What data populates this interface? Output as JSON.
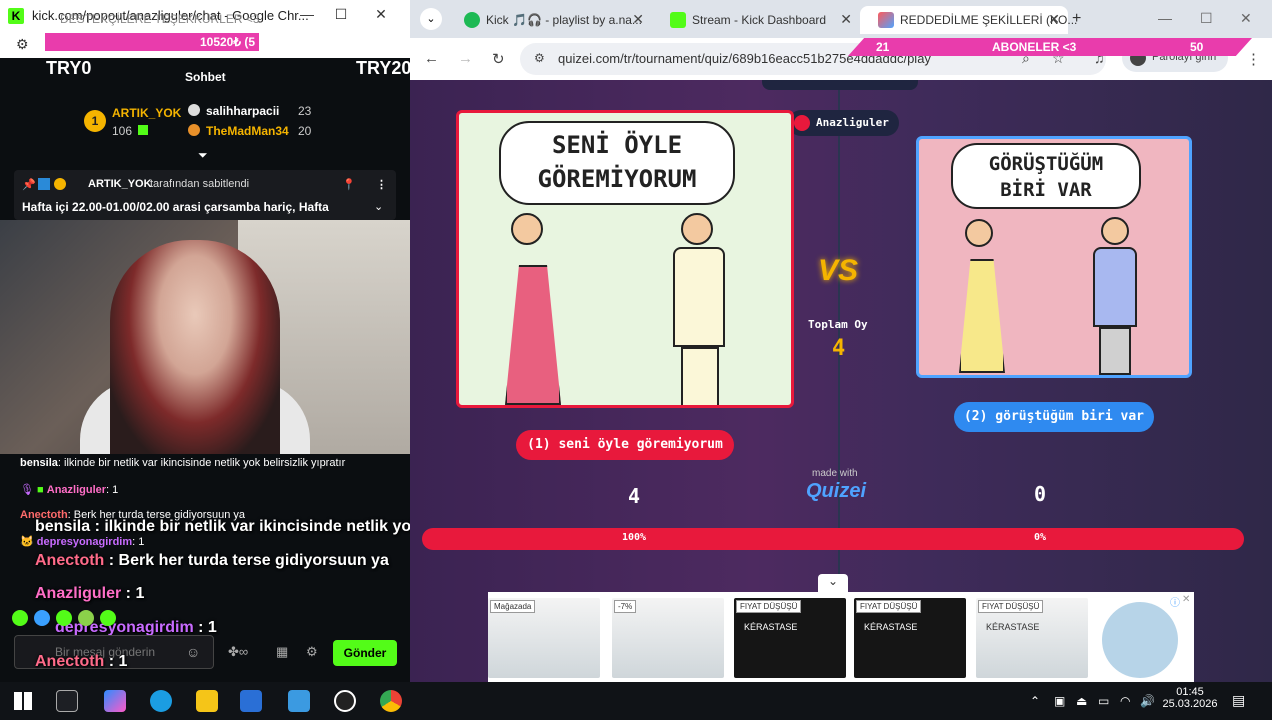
{
  "left_window": {
    "title": "kick.com/popout/anazliguler/chat - Google Chr...",
    "progress_text": "10520₺ (5",
    "overlay_faded": "DESTEKÇİLERE TEŞEKKÜRLER <3",
    "try_left": "TRY0",
    "try_right": "TRY20...",
    "tab_title": "Sohbet",
    "leaders": [
      {
        "name": "ARTIK_YOK",
        "count": "106",
        "rank": "1"
      },
      {
        "name": "salihharpacii",
        "count": "23"
      },
      {
        "name": "TheMadMan34",
        "count": "20"
      }
    ],
    "pinned": {
      "by": "ARTIK_YOK",
      "suffix": "tarafından sabitlendi",
      "text": "Hafta içi 22.00-01.00/02.00 arasi çarsamba hariç, Hafta"
    },
    "chat": [
      {
        "user": "bensila",
        "sep": ":",
        "text": "ilkinde bir netlik var ikincisinde netlik yok belirsizlik yıpratır"
      },
      {
        "user": "Anazliguler",
        "sep": ":",
        "text": "1"
      },
      {
        "user": "Anectoth",
        "sep": ":",
        "text": "Berk her turda terse gidiyorsuun ya"
      },
      {
        "user": "depresyonagirdim",
        "sep": ":",
        "text": "1"
      }
    ],
    "overlay": [
      {
        "user": "bensila",
        "sep": " : ",
        "text": "ilkinde bir netlik var ikincisinde netlik yok belirsizlik yıpratır"
      },
      {
        "user": "Anectoth",
        "sep": " : ",
        "text": "Berk her turda terse gidiyorsuun ya"
      },
      {
        "user": "Anazliguler",
        "sep": " : ",
        "text": "1"
      },
      {
        "user": "depresyonagirdim",
        "sep": " : ",
        "text": "1"
      },
      {
        "user": "Anectoth",
        "sep": " : ",
        "text": "1"
      }
    ],
    "input_placeholder": "Bir mesaj gönderin",
    "send_label": "Gönder",
    "colors": {
      "kick_green": "#53fc18",
      "pink": "#e93cac"
    }
  },
  "browser": {
    "tabs": [
      {
        "label": "Kick 🎵🎧 - playlist by a.na...",
        "icon": "spotify-icon",
        "color": "#1db954"
      },
      {
        "label": "Stream - Kick Dashboard",
        "icon": "kick-icon",
        "color": "#53fc18"
      },
      {
        "label": "REDDEDİLME ŞEKİLLERİ (KO...",
        "icon": "quizei-icon",
        "color": "#ff5a5a"
      }
    ],
    "new_tab": "+",
    "url": "quizei.com/tr/tournament/quiz/689b16eacc51b275e4ddaddc/play",
    "profile_label": "Parolayı girin",
    "sub_banner": {
      "left": "21",
      "center": "ABONELER <3",
      "right": "50"
    }
  },
  "quiz": {
    "creator": "Anazliguler",
    "left_card": {
      "bubble_line1": "SENİ ÖYLE",
      "bubble_line2": "GÖREMİYORUM",
      "button": "(1) seni öyle göremiyorum",
      "votes": "4",
      "percent": "100%"
    },
    "right_card": {
      "bubble_line1": "GÖRÜŞTÜĞÜM",
      "bubble_line2": "BİRİ VAR",
      "button": "(2) görüştüğüm biri var",
      "votes": "0",
      "percent": "0%"
    },
    "vs": "VS",
    "total_label": "Toplam Oy",
    "total_votes": "4",
    "made_with": "made with",
    "brand": "Quizei"
  },
  "ads": {
    "labels": [
      "Mağazada",
      "-7%",
      "FIYAT DÜŞÜŞÜ",
      "FIYAT DÜŞÜŞÜ",
      "FIYAT DÜŞÜŞÜ"
    ],
    "brand": "KÉRASTASE"
  },
  "taskbar": {
    "time": "01:45",
    "date": "25.03.2026"
  }
}
